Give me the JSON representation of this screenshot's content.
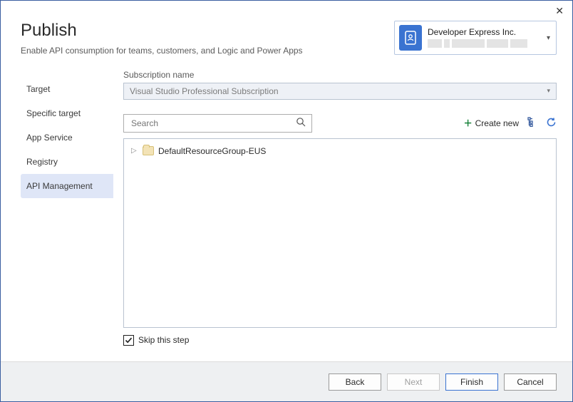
{
  "header": {
    "title": "Publish",
    "subtitle": "Enable API consumption for teams, customers, and Logic and Power Apps"
  },
  "account": {
    "name": "Developer Express Inc."
  },
  "sidebar": {
    "items": [
      {
        "label": "Target"
      },
      {
        "label": "Specific target"
      },
      {
        "label": "App Service"
      },
      {
        "label": "Registry"
      },
      {
        "label": "API Management"
      }
    ],
    "selected_index": 4
  },
  "main": {
    "subscription_label": "Subscription name",
    "subscription_value": "Visual Studio Professional Subscription",
    "search_placeholder": "Search",
    "create_new_label": "Create new",
    "tree": {
      "items": [
        {
          "label": "DefaultResourceGroup-EUS"
        }
      ]
    },
    "skip_label": "Skip this step",
    "skip_checked": true
  },
  "footer": {
    "back": "Back",
    "next": "Next",
    "finish": "Finish",
    "cancel": "Cancel"
  }
}
